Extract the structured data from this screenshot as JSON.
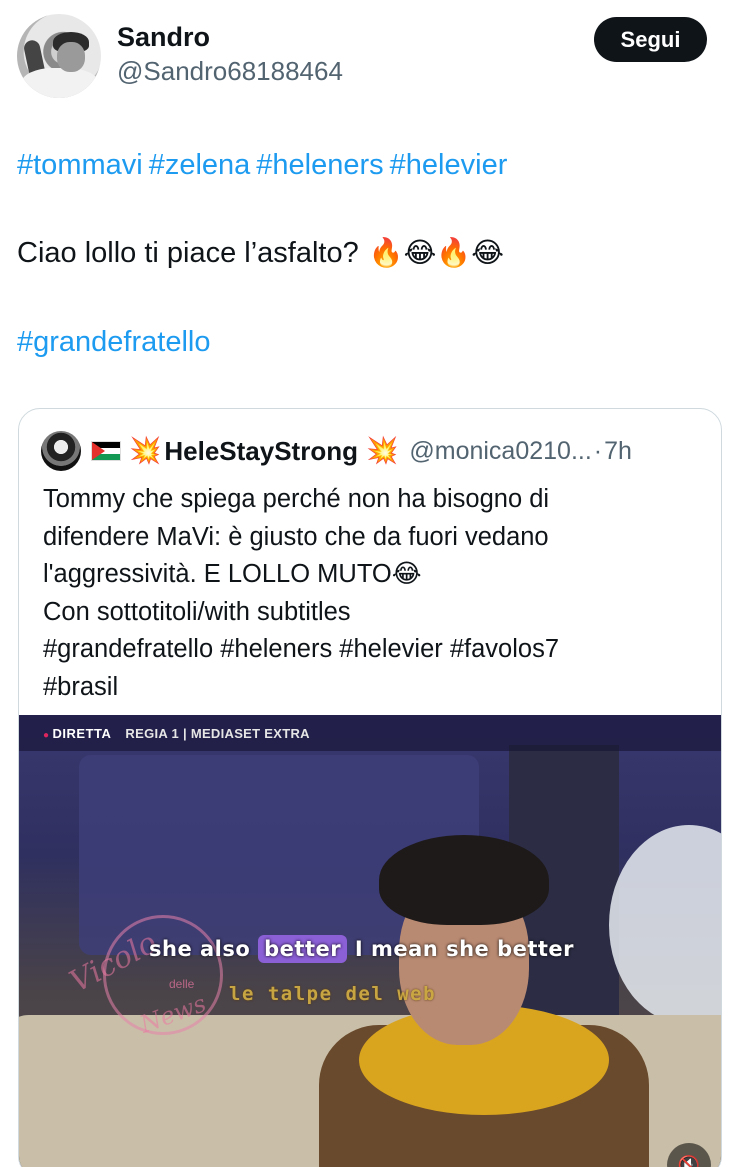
{
  "author": {
    "display_name": "Sandro",
    "handle": "@Sandro68188464",
    "follow_label": "Segui"
  },
  "tweet": {
    "hashtags_line1": [
      "#tommavi",
      "#zelena",
      "#heleners",
      "#helevier"
    ],
    "text": "Ciao lollo ti piace l’asfalto?",
    "text_emojis": "🔥😂🔥😂",
    "hashtags_line2": [
      "#grandefratello"
    ]
  },
  "quoted": {
    "flag": "palestine-flag",
    "spark_icon": "💥",
    "name": "HeleStayStrong",
    "handle": "@monica0210...",
    "dot": "·",
    "time": "7h",
    "lines": [
      "Tommy che spiega perché non ha bisogno di",
      "difendere MaVi: è giusto che da fuori vedano",
      "l'aggressività.  E LOLLO MUTO😂",
      "Con sottotitoli/with subtitles",
      "#grandefratello #heleners #helevier #favolos7",
      "#brasil"
    ]
  },
  "video": {
    "live_label": "DIRETTA",
    "channel": "REGIA 1 | MEDIASET EXTRA",
    "subtitle_before": "she also ",
    "subtitle_highlight": "better",
    "subtitle_after": " I mean she better",
    "watermark_1": "Vicolo",
    "watermark_1_small": "delle",
    "watermark_1_bottom": "News",
    "watermark_2": "le talpe del web",
    "mute_icon": "🔇"
  },
  "colors": {
    "link": "#1d9bf0",
    "secondary_text": "#536471",
    "primary_text": "#0f1419",
    "follow_bg": "#0f1419",
    "subtitle_highlight": "#8b5fd6"
  }
}
